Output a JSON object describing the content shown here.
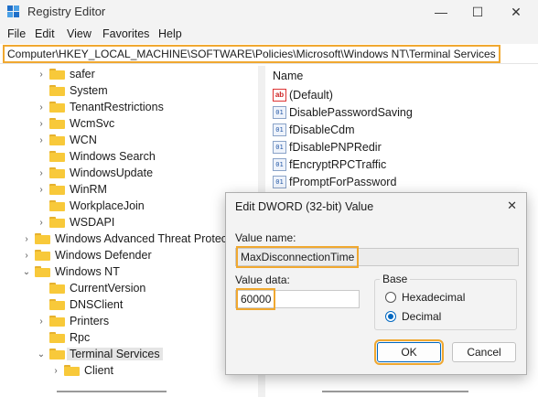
{
  "window": {
    "title": "Registry Editor",
    "icon": "registry-editor-icon",
    "controls": {
      "minimize": "—",
      "maximize": "☐",
      "close": "✕"
    }
  },
  "menu": [
    "File",
    "Edit",
    "View",
    "Favorites",
    "Help"
  ],
  "address": "Computer\\HKEY_LOCAL_MACHINE\\SOFTWARE\\Policies\\Microsoft\\Windows NT\\Terminal Services",
  "tree": [
    {
      "label": "safer",
      "expander": "›"
    },
    {
      "label": "System",
      "expander": ""
    },
    {
      "label": "TenantRestrictions",
      "expander": "›"
    },
    {
      "label": "WcmSvc",
      "expander": "›"
    },
    {
      "label": "WCN",
      "expander": "›"
    },
    {
      "label": "Windows Search",
      "expander": ""
    },
    {
      "label": "WindowsUpdate",
      "expander": "›"
    },
    {
      "label": "WinRM",
      "expander": "›"
    },
    {
      "label": "WorkplaceJoin",
      "expander": ""
    },
    {
      "label": "WSDAPI",
      "expander": "›"
    },
    {
      "label": "Windows Advanced Threat Protection",
      "expander": "›"
    },
    {
      "label": "Windows Defender",
      "expander": "›"
    },
    {
      "label": "Windows NT",
      "expander": "⌄"
    },
    {
      "label": "CurrentVersion",
      "expander": ""
    },
    {
      "label": "DNSClient",
      "expander": ""
    },
    {
      "label": "Printers",
      "expander": "›"
    },
    {
      "label": "Rpc",
      "expander": ""
    },
    {
      "label": "Terminal Services",
      "expander": "⌄",
      "selected": true
    },
    {
      "label": "Client",
      "expander": "›"
    }
  ],
  "values_header": "Name",
  "values": [
    {
      "name": "(Default)",
      "type": "string"
    },
    {
      "name": "DisablePasswordSaving",
      "type": "dword"
    },
    {
      "name": "fDisableCdm",
      "type": "dword"
    },
    {
      "name": "fDisablePNPRedir",
      "type": "dword"
    },
    {
      "name": "fEncryptRPCTraffic",
      "type": "dword"
    },
    {
      "name": "fPromptForPassword",
      "type": "dword"
    }
  ],
  "dialog": {
    "title": "Edit DWORD (32-bit) Value",
    "close": "✕",
    "value_name_label": "Value name:",
    "value_name": "MaxDisconnectionTime",
    "value_data_label": "Value data:",
    "value_data": "60000",
    "base_label": "Base",
    "base_options": [
      "Hexadecimal",
      "Decimal"
    ],
    "base_selected": "Decimal",
    "ok_label": "OK",
    "cancel_label": "Cancel"
  },
  "colors": {
    "highlight": "#f0a830",
    "accent": "#0067c0",
    "folder": "#f8c93a"
  }
}
